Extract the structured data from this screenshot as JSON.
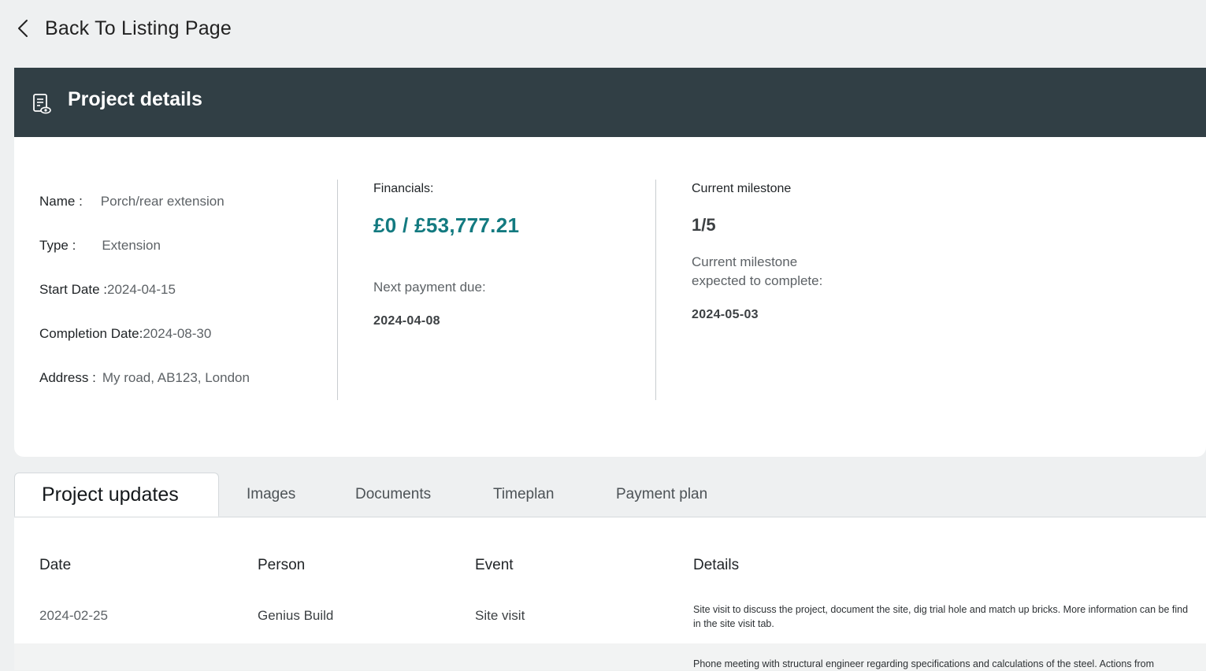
{
  "back": {
    "label": "Back To Listing Page"
  },
  "card": {
    "title": "Project details",
    "info": [
      {
        "key": "Name :",
        "value": "Porch/rear extension"
      },
      {
        "key": "Type :",
        "value": "Extension"
      },
      {
        "key": "Start Date :",
        "value": "2024-04-15"
      },
      {
        "key": "Completion Date:",
        "value": "2024-08-30"
      },
      {
        "key": "Address :",
        "value": "My road, AB123, London"
      }
    ],
    "financials": {
      "title": "Financials:",
      "amount": "£0 / £53,777.21",
      "next_label": "Next payment due:",
      "next_date": "2024-04-08"
    },
    "milestone": {
      "title": "Current milestone",
      "count": "1/5",
      "expected_line1": "Current milestone",
      "expected_line2": "expected to complete:",
      "expected_date": "2024-05-03"
    }
  },
  "tabs": [
    {
      "label": "Project updates",
      "active": true
    },
    {
      "label": "Images"
    },
    {
      "label": "Documents"
    },
    {
      "label": "Timeplan"
    },
    {
      "label": "Payment plan"
    }
  ],
  "table": {
    "headers": [
      "Date",
      "Person",
      "Event",
      "Details"
    ],
    "rows": [
      {
        "date": "2024-02-25",
        "person": "Genius Build",
        "event": "Site visit",
        "details": "Site visit to discuss the project, document the site, dig trial hole and match up bricks. More information can be find in the site visit tab."
      },
      {
        "date": "",
        "person": "",
        "event": "",
        "details": "Phone meeting with structural engineer regarding specifications and calculations of the steel. Actions from"
      }
    ]
  },
  "colors": {
    "header_bg": "#313f45",
    "accent": "#137a80",
    "page_bg": "#eef0f1"
  },
  "icons": {
    "back": "chevron-left-icon",
    "header": "document-view-icon"
  }
}
